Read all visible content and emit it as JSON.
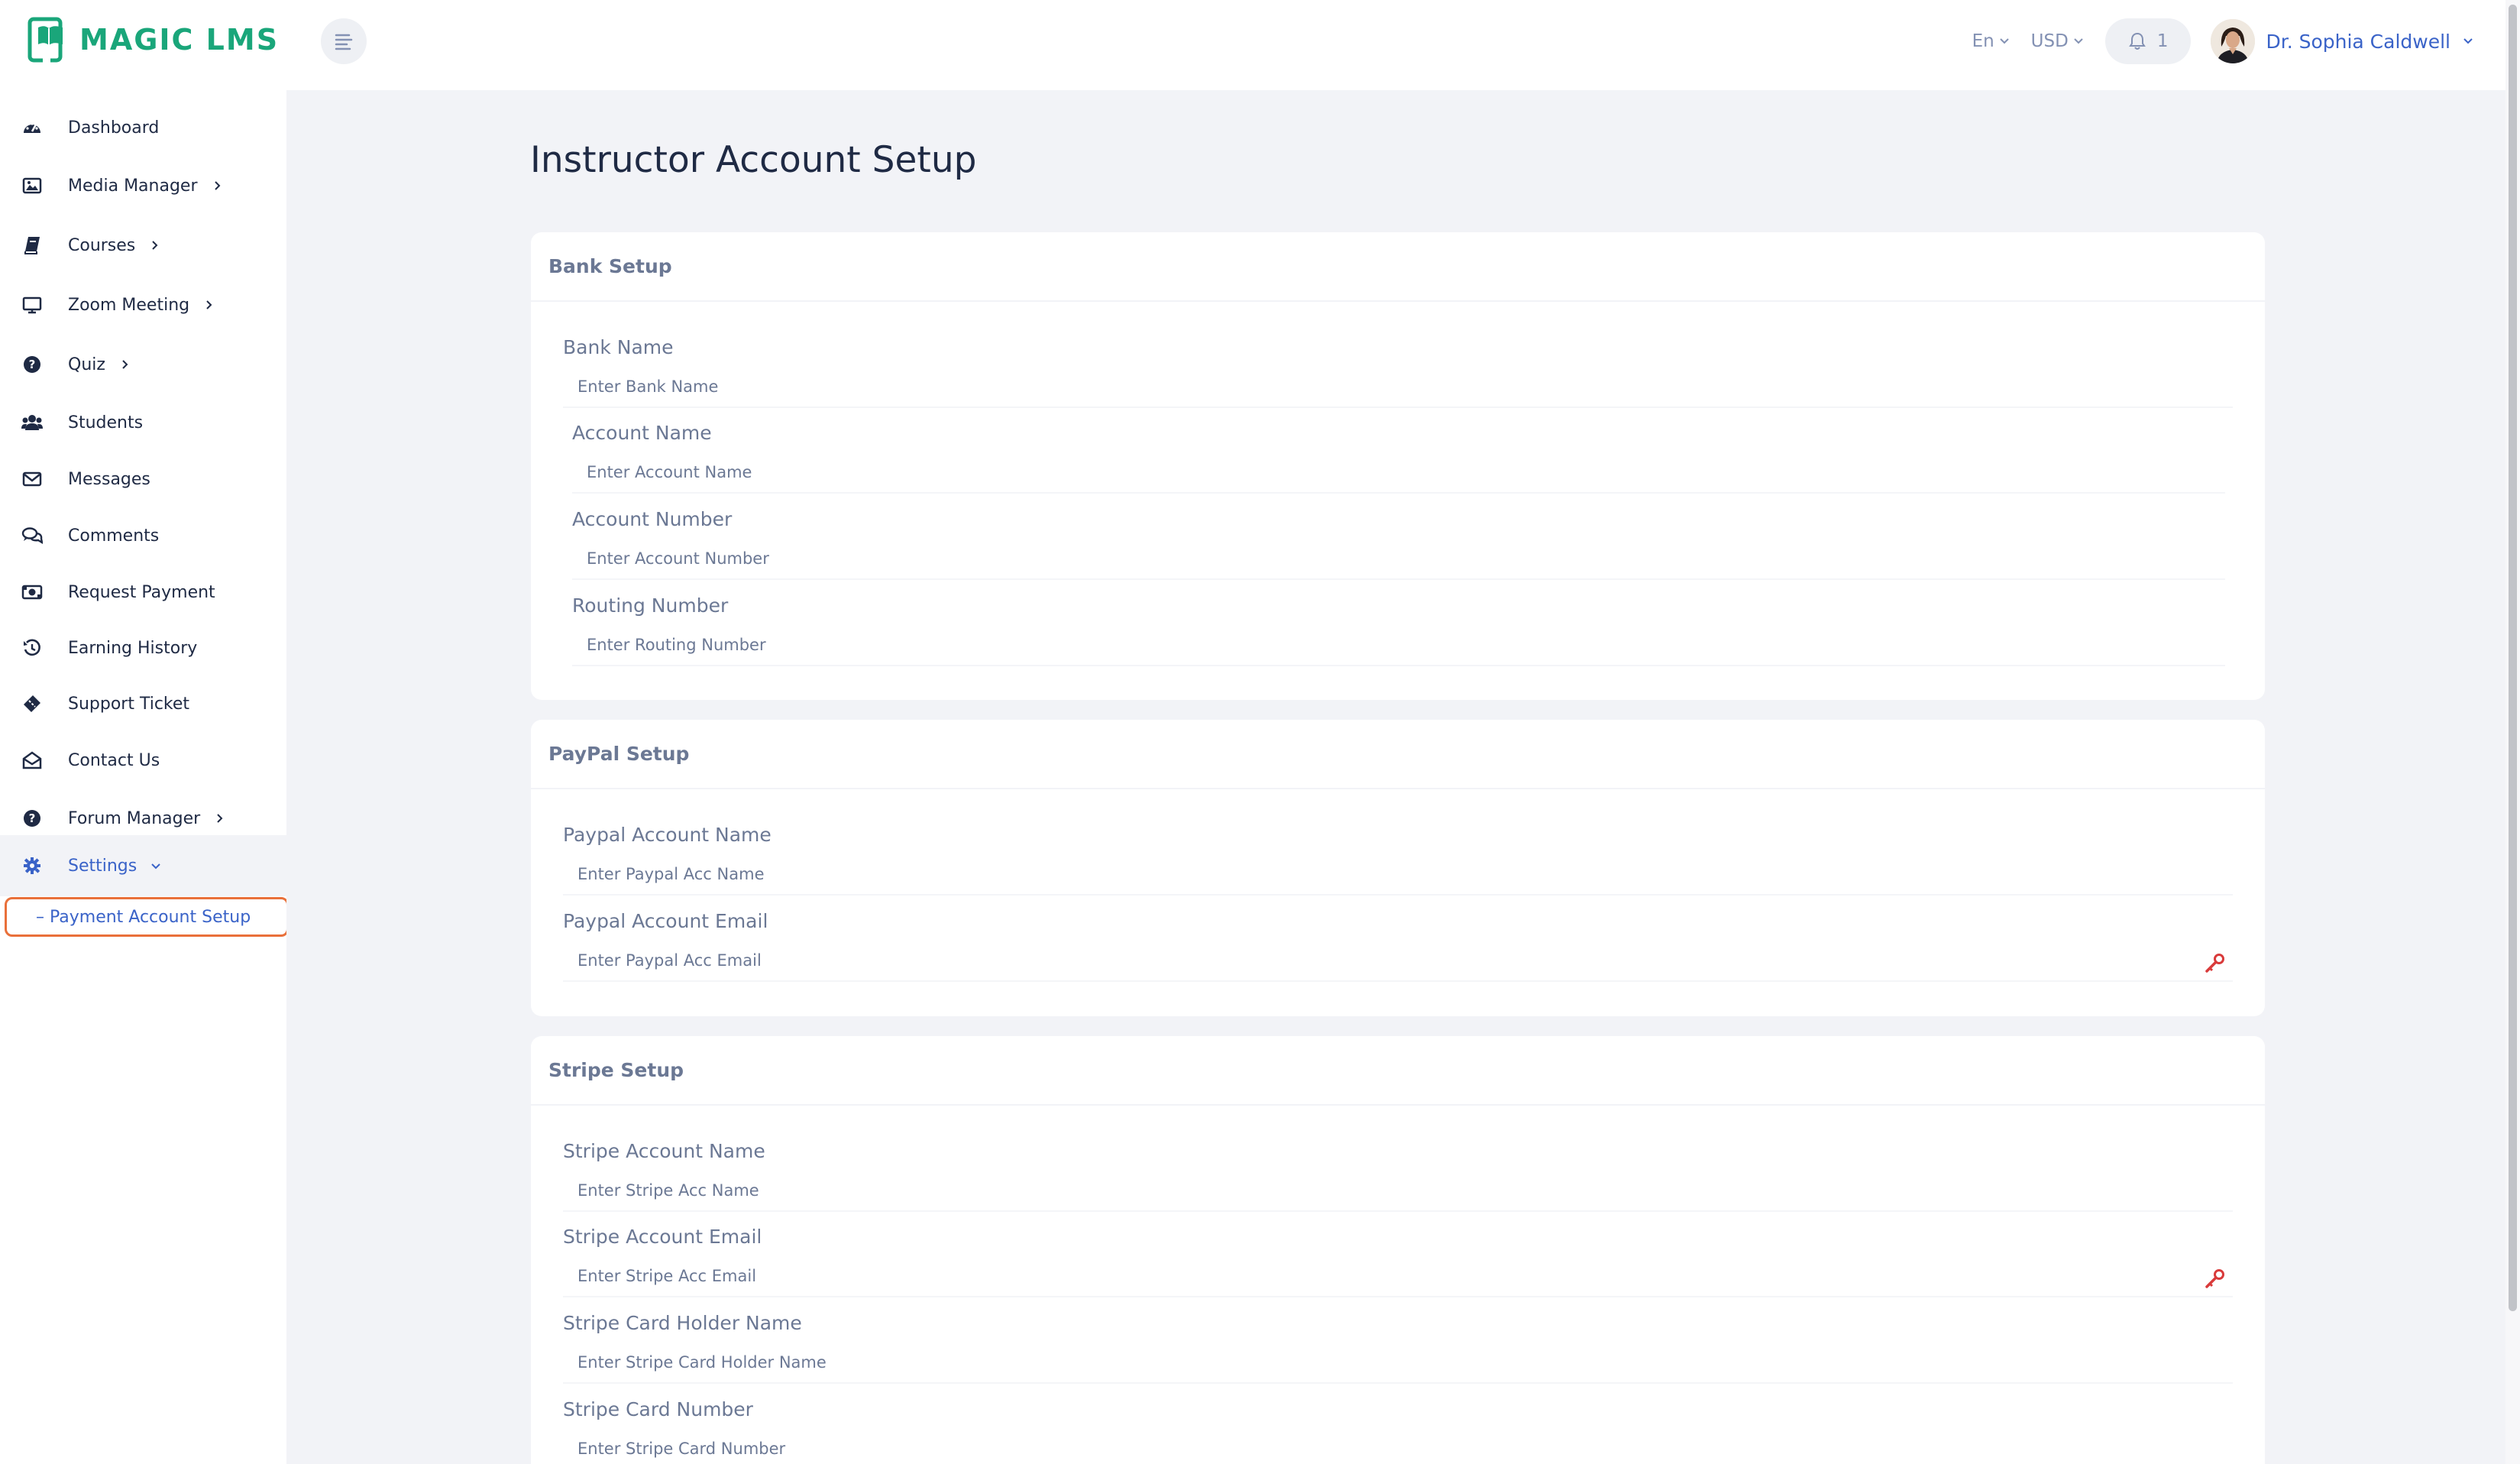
{
  "app": {
    "logo_text": "MAGIC LMS"
  },
  "header": {
    "language": "En",
    "currency": "USD",
    "notification_count": "1",
    "user_name": "Dr. Sophia Caldwell"
  },
  "sidebar": {
    "items": [
      {
        "label": "Dashboard",
        "icon": "dashboard-icon"
      },
      {
        "label": "Media Manager",
        "icon": "image-icon"
      },
      {
        "label": "Courses",
        "icon": "book-icon"
      },
      {
        "label": "Zoom Meeting",
        "icon": "monitor-icon"
      },
      {
        "label": "Quiz",
        "icon": "question-icon"
      },
      {
        "label": "Students",
        "icon": "users-icon"
      },
      {
        "label": "Messages",
        "icon": "envelope-icon"
      },
      {
        "label": "Comments",
        "icon": "comments-icon"
      },
      {
        "label": "Request Payment",
        "icon": "money-icon"
      },
      {
        "label": "Earning History",
        "icon": "history-icon"
      },
      {
        "label": "Support Ticket",
        "icon": "ticket-icon"
      },
      {
        "label": "Contact Us",
        "icon": "envelope-open-icon"
      },
      {
        "label": "Forum Manager",
        "icon": "question-icon"
      },
      {
        "label": "Settings",
        "icon": "gear-icon"
      }
    ],
    "sub_item": "– Payment Account Setup"
  },
  "main": {
    "title": "Instructor Account Setup",
    "bank": {
      "header": "Bank Setup",
      "bank_name_label": "Bank Name",
      "bank_name_placeholder": "Enter Bank Name",
      "account_name_label": "Account Name",
      "account_name_placeholder": "Enter Account Name",
      "account_number_label": "Account Number",
      "account_number_placeholder": "Enter Account Number",
      "routing_number_label": "Routing Number",
      "routing_number_placeholder": "Enter Routing Number"
    },
    "paypal": {
      "header": "PayPal Setup",
      "acc_name_label": "Paypal Account Name",
      "acc_name_placeholder": "Enter Paypal Acc Name",
      "acc_email_label": "Paypal Account Email",
      "acc_email_placeholder": "Enter Paypal Acc Email"
    },
    "stripe": {
      "header": "Stripe Setup",
      "acc_name_label": "Stripe Account Name",
      "acc_name_placeholder": "Enter Stripe Acc Name",
      "acc_email_label": "Stripe Account Email",
      "acc_email_placeholder": "Enter Stripe Acc Email",
      "holder_label": "Stripe Card Holder Name",
      "holder_placeholder": "Enter Stripe Card Holder Name",
      "card_number_label": "Stripe Card Number",
      "card_number_placeholder": "Enter Stripe Card Number"
    }
  },
  "colors": {
    "accent": "#3a63c8",
    "brand": "#1aa67a",
    "highlight_border": "#e9703a",
    "key_icon": "#d93a3a",
    "background": "#f2f3f7"
  }
}
